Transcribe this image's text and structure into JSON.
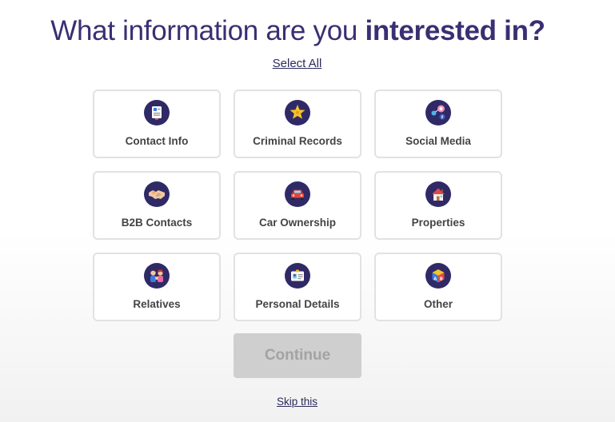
{
  "header": {
    "title_light": "What information are you ",
    "title_bold": "interested in?",
    "select_all": "Select All"
  },
  "options": [
    {
      "label": "Contact Info",
      "icon": "contact-card-icon"
    },
    {
      "label": "Criminal Records",
      "icon": "sheriff-star-icon"
    },
    {
      "label": "Social Media",
      "icon": "social-network-icon"
    },
    {
      "label": "B2B Contacts",
      "icon": "handshake-icon"
    },
    {
      "label": "Car Ownership",
      "icon": "car-icon"
    },
    {
      "label": "Properties",
      "icon": "house-icon"
    },
    {
      "label": "Relatives",
      "icon": "family-icon"
    },
    {
      "label": "Personal Details",
      "icon": "id-badge-icon"
    },
    {
      "label": "Other",
      "icon": "cube-icon"
    }
  ],
  "footer": {
    "continue_label": "Continue",
    "skip_label": "Skip this"
  },
  "colors": {
    "brand_purple": "#3a2f72",
    "icon_bg": "#2f2a66",
    "card_border": "#e2e2e2",
    "button_disabled_bg": "#cfcfcf",
    "button_disabled_text": "#a3a3a3"
  }
}
